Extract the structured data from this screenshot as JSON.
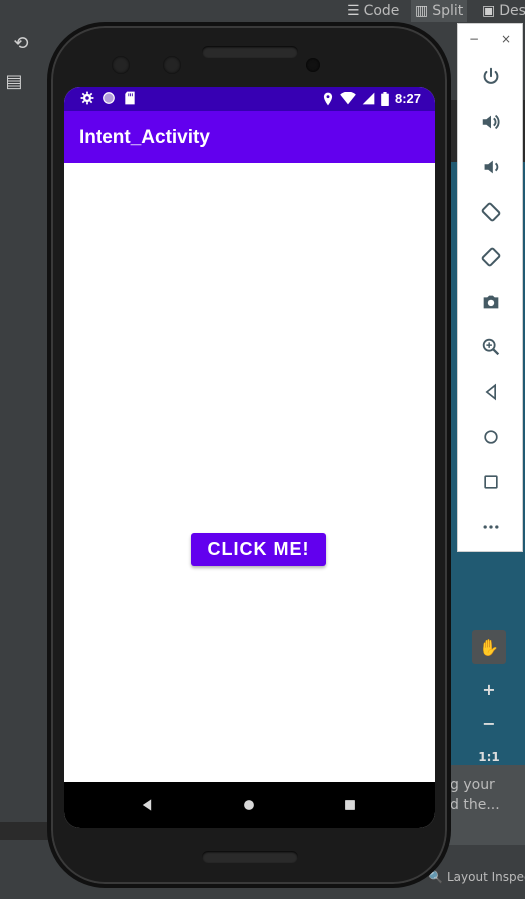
{
  "ide": {
    "tabs": [
      {
        "icon": "lines-icon",
        "label": "Code"
      },
      {
        "icon": "split-icon",
        "label": "Split"
      },
      {
        "icon": "image-icon",
        "label": "Des"
      }
    ],
    "hint": {
      "line1": "g your",
      "line2": "d the..."
    },
    "status_right": "Layout Inspec",
    "zoom": {
      "zoom_in": "+",
      "zoom_out": "−",
      "one_to_one": "1:1"
    }
  },
  "emulator_toolbar": {
    "minimize": "−",
    "close": "×",
    "buttons": [
      "power-icon",
      "volume-up-icon",
      "volume-down-icon",
      "rotate-left-icon",
      "rotate-right-icon",
      "camera-icon",
      "zoom-icon",
      "back-icon",
      "home-icon",
      "overview-icon",
      "more-icon"
    ]
  },
  "device": {
    "status_bar": {
      "time": "8:27",
      "color": "#3700b3"
    },
    "app": {
      "title": "Intent_Activity",
      "primary_color": "#6200ee",
      "button_label": "CLICK ME!"
    }
  }
}
